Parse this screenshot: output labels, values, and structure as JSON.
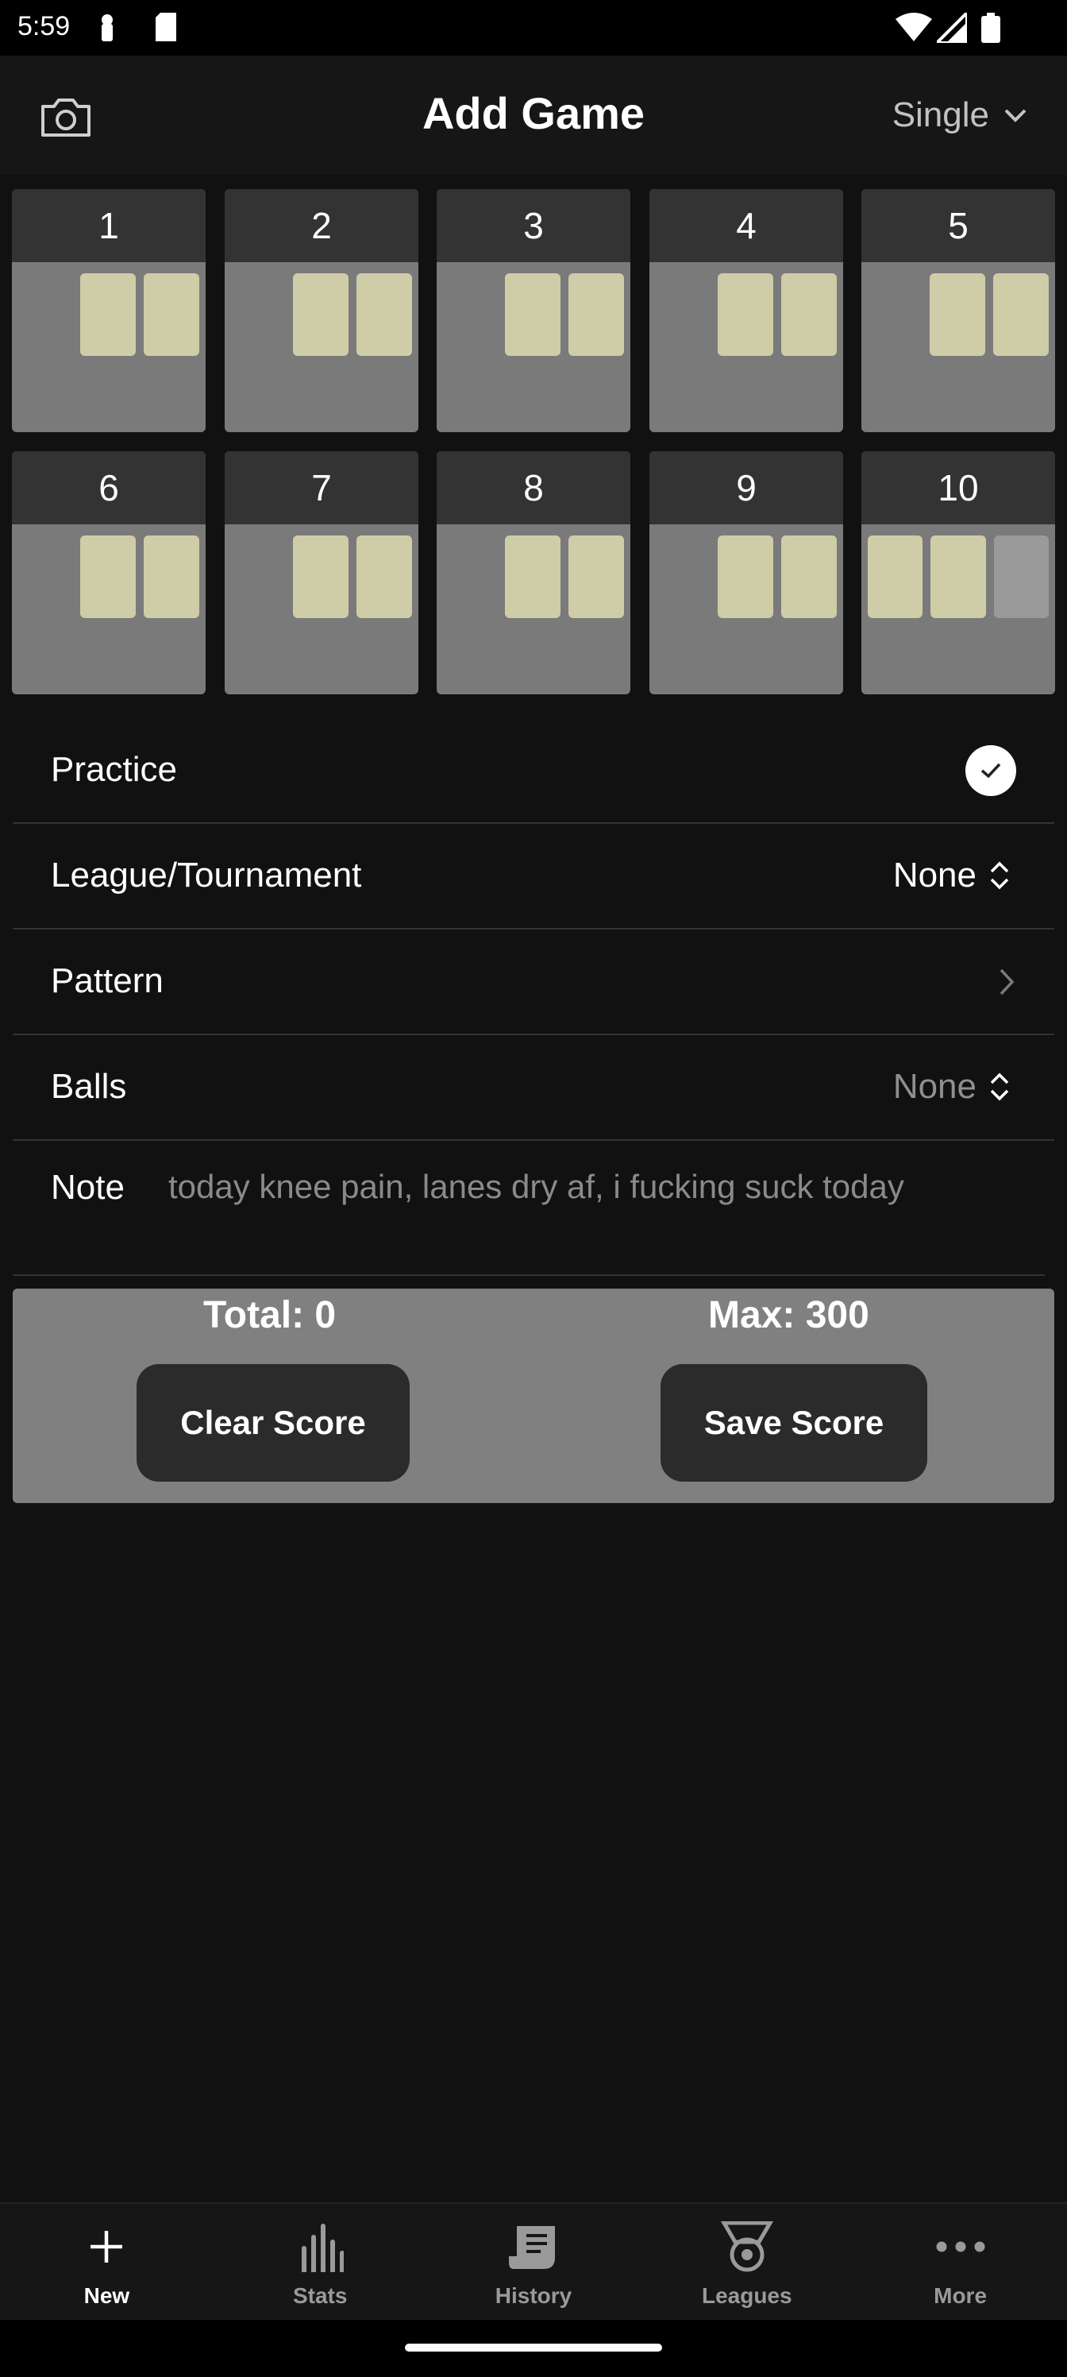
{
  "status_bar": {
    "time": "5:59"
  },
  "header": {
    "title": "Add Game",
    "mode": "Single"
  },
  "frames": [
    {
      "number": "1"
    },
    {
      "number": "2"
    },
    {
      "number": "3"
    },
    {
      "number": "4"
    },
    {
      "number": "5"
    },
    {
      "number": "6"
    },
    {
      "number": "7"
    },
    {
      "number": "8"
    },
    {
      "number": "9"
    },
    {
      "number": "10"
    }
  ],
  "settings": {
    "practice": {
      "label": "Practice",
      "checked": true
    },
    "league": {
      "label": "League/Tournament",
      "value": "None"
    },
    "pattern": {
      "label": "Pattern"
    },
    "balls": {
      "label": "Balls",
      "value": "None"
    },
    "note": {
      "label": "Note",
      "value": "today knee pain, lanes dry af, i fucking suck today"
    }
  },
  "score": {
    "total": "Total: 0",
    "max": "Max: 300",
    "clear_label": "Clear Score",
    "save_label": "Save Score"
  },
  "nav": {
    "items": [
      {
        "label": "New",
        "icon": "plus-icon",
        "active": true
      },
      {
        "label": "Stats",
        "icon": "bar-chart-icon",
        "active": false
      },
      {
        "label": "History",
        "icon": "scroll-icon",
        "active": false
      },
      {
        "label": "Leagues",
        "icon": "medal-icon",
        "active": false
      },
      {
        "label": "More",
        "icon": "more-icon",
        "active": false
      }
    ]
  },
  "colors": {
    "background": "#111111",
    "frame_head": "#333333",
    "frame_body": "#7a7a7a",
    "ball_box": "#cfcca8",
    "score_panel": "#808080",
    "button": "#2b2b2b"
  }
}
